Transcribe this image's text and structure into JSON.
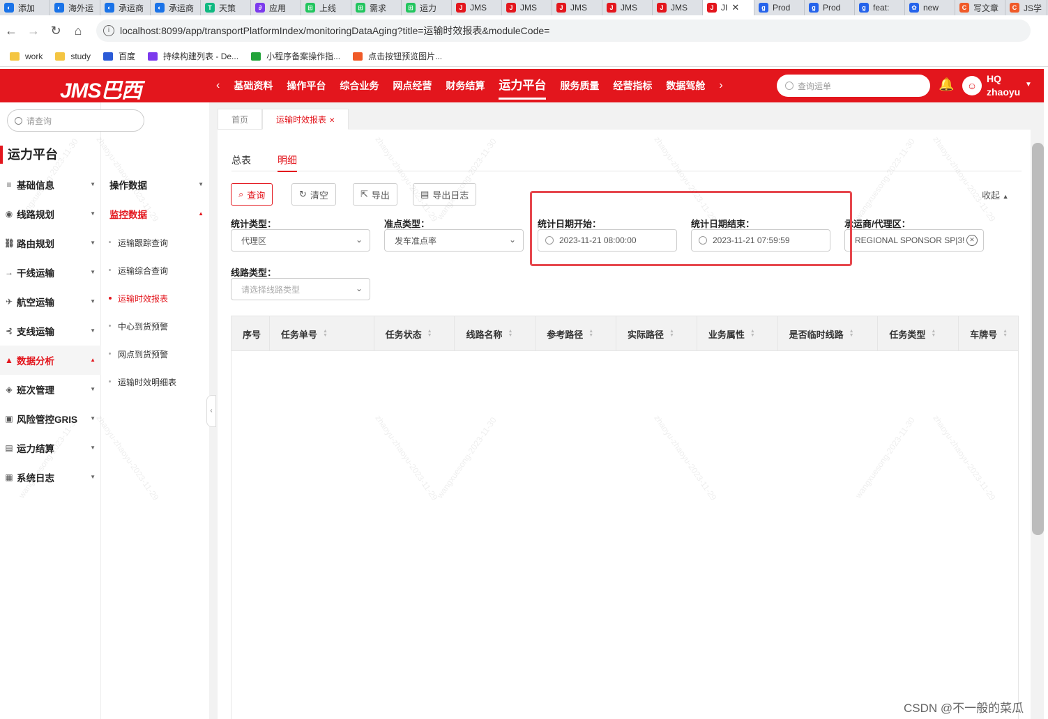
{
  "browser": {
    "tabs": [
      {
        "label": "添加",
        "color": "#1a73e8",
        "glyph": "◐"
      },
      {
        "label": "海外运",
        "color": "#1a73e8",
        "glyph": "◐"
      },
      {
        "label": "承运商",
        "color": "#1a73e8",
        "glyph": "◐"
      },
      {
        "label": "承运商",
        "color": "#1a73e8",
        "glyph": "◐"
      },
      {
        "label": "天策",
        "color": "#10b981",
        "glyph": "T"
      },
      {
        "label": "应用",
        "color": "#7c3aed",
        "glyph": "∂"
      },
      {
        "label": "上线",
        "color": "#22c55e",
        "glyph": "⊞"
      },
      {
        "label": "需求",
        "color": "#22c55e",
        "glyph": "⊞"
      },
      {
        "label": "运力",
        "color": "#22c55e",
        "glyph": "⊞"
      },
      {
        "label": "JMS",
        "color": "#e3161d",
        "glyph": "J"
      },
      {
        "label": "JMS",
        "color": "#e3161d",
        "glyph": "J"
      },
      {
        "label": "JMS",
        "color": "#e3161d",
        "glyph": "J"
      },
      {
        "label": "JMS",
        "color": "#e3161d",
        "glyph": "J"
      },
      {
        "label": "JMS",
        "color": "#e3161d",
        "glyph": "J"
      },
      {
        "label": "JI",
        "color": "#e3161d",
        "glyph": "J",
        "active": true
      },
      {
        "label": "Prod",
        "color": "#2563eb",
        "glyph": "g"
      },
      {
        "label": "Prod",
        "color": "#2563eb",
        "glyph": "g"
      },
      {
        "label": "feat:",
        "color": "#2563eb",
        "glyph": "g"
      },
      {
        "label": "new",
        "color": "#2563eb",
        "glyph": "✿"
      },
      {
        "label": "写文章",
        "color": "#f05a28",
        "glyph": "C"
      },
      {
        "label": "JS学",
        "color": "#f05a28",
        "glyph": "C"
      }
    ],
    "url": "localhost:8099/app/transportPlatformIndex/monitoringDataAging?title=运输时效报表&moduleCode=",
    "bookmarks": [
      {
        "label": "work",
        "color": "#f4c542"
      },
      {
        "label": "study",
        "color": "#f4c542"
      },
      {
        "label": "百度",
        "color": "#2b5bd7"
      },
      {
        "label": "持续构建列表 - De...",
        "color": "#7c3aed"
      },
      {
        "label": "小程序备案操作指...",
        "color": "#22a33a"
      },
      {
        "label": "点击按钮预览图片...",
        "color": "#f05a28"
      }
    ]
  },
  "header": {
    "logo": "JMS巴西",
    "nav": [
      "基础资料",
      "操作平台",
      "综合业务",
      "网点经营",
      "财务结算",
      "运力平台",
      "服务质量",
      "经营指标",
      "数据驾舱"
    ],
    "active_nav": "运力平台",
    "search_placeholder": "查询运单",
    "user_org": "HQ",
    "user_name": "zhaoyu"
  },
  "sidebar": {
    "search_placeholder": "请查询",
    "title": "运力平台",
    "level1": [
      {
        "label": "基础信息",
        "icon": "≡"
      },
      {
        "label": "线路规划",
        "icon": "◉"
      },
      {
        "label": "路由规划",
        "icon": "⛓"
      },
      {
        "label": "干线运输",
        "icon": "→"
      },
      {
        "label": "航空运输",
        "icon": "✈"
      },
      {
        "label": "支线运输",
        "icon": "⊰"
      },
      {
        "label": "数据分析",
        "icon": "▲",
        "active": true
      },
      {
        "label": "班次管理",
        "icon": "◈"
      },
      {
        "label": "风险管控GRIS",
        "icon": "▣"
      },
      {
        "label": "运力结算",
        "icon": "▤"
      },
      {
        "label": "系统日志",
        "icon": "▦"
      }
    ],
    "level2": [
      {
        "label": "操作数据",
        "open": false
      },
      {
        "label": "监控数据",
        "open": true
      }
    ],
    "level3": [
      {
        "label": "运输跟踪查询"
      },
      {
        "label": "运输综合查询"
      },
      {
        "label": "运输时效报表",
        "active": true
      },
      {
        "label": "中心到货预警"
      },
      {
        "label": "网点到货预警"
      },
      {
        "label": "运输时效明细表"
      }
    ]
  },
  "page_tabs": [
    {
      "label": "首页",
      "active": false
    },
    {
      "label": "运输时效报表",
      "active": true
    }
  ],
  "sub_tabs": [
    {
      "label": "总表",
      "active": false
    },
    {
      "label": "明细",
      "active": true
    }
  ],
  "buttons": {
    "query": "查询",
    "clear": "清空",
    "export": "导出",
    "export_log": "导出日志",
    "collapse": "收起"
  },
  "filters": {
    "stat_type_label": "统计类型：",
    "stat_type_value": "代理区",
    "ontime_type_label": "准点类型：",
    "ontime_type_value": "发车准点率",
    "start_date_label": "统计日期开始：",
    "start_date_value": "2023-11-21 08:00:00",
    "end_date_label": "统计日期结束：",
    "end_date_value": "2023-11-21 07:59:59",
    "carrier_label": "承运商/代理区：",
    "carrier_value": "REGIONAL SPONSOR SP|3!",
    "line_type_label": "线路类型：",
    "line_type_placeholder": "请选择线路类型"
  },
  "table": {
    "columns": [
      {
        "label": "序号",
        "sortable": false,
        "width": 55
      },
      {
        "label": "任务单号",
        "sortable": true,
        "width": 150
      },
      {
        "label": "任务状态",
        "sortable": true,
        "width": 116
      },
      {
        "label": "线路名称",
        "sortable": true,
        "width": 116
      },
      {
        "label": "参考路径",
        "sortable": true,
        "width": 116
      },
      {
        "label": "实际路径",
        "sortable": true,
        "width": 116
      },
      {
        "label": "业务属性",
        "sortable": true,
        "width": 116
      },
      {
        "label": "是否临时线路",
        "sortable": true,
        "width": 144
      },
      {
        "label": "任务类型",
        "sortable": true,
        "width": 116
      },
      {
        "label": "车牌号",
        "sortable": true,
        "width": 85
      }
    ]
  },
  "watermark": {
    "texts": [
      "zhaoyu-zhaoyu-2023-11-29",
      "wangxuesong-2023-11-30"
    ]
  },
  "csdn_credit": "CSDN @不一般的菜瓜"
}
